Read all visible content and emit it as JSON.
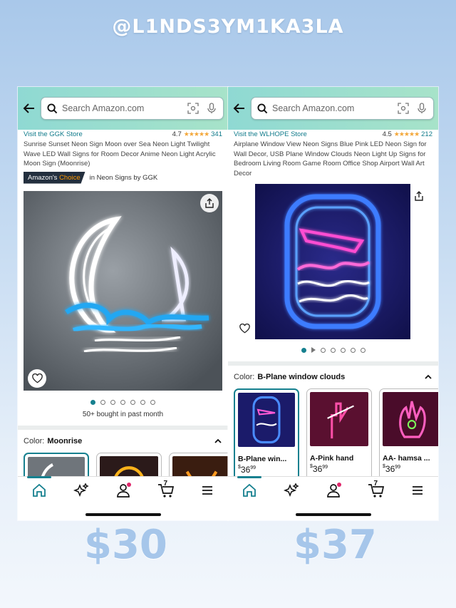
{
  "handle": "@L1NDS3YM1KA3LA",
  "left": {
    "search_placeholder": "Search Amazon.com",
    "store": "Visit the GGK Store",
    "rating": "4.7",
    "stars": "★★★★★",
    "rating_count": "341",
    "title": "Sunrise Sunset Neon Sign Moon over Sea Neon Light Twilight Wave LED Wall Signs for Room Decor Anime Neon Light Acrylic Moon Sign (Moonrise)",
    "choice_prefix": "Amazon's",
    "choice_word": "Choice",
    "choice_category": "in Neon Signs by GGK",
    "bought": "50+ bought in past month",
    "color_label": "Color:",
    "color_value": "Moonrise",
    "swatches": [
      {
        "name": "",
        "price": ""
      },
      {
        "name": "",
        "price": ""
      },
      {
        "name": "",
        "price": ""
      }
    ],
    "cart_count": "7",
    "price_overlay": "$30"
  },
  "right": {
    "search_placeholder": "Search Amazon.com",
    "store": "Visit the WLHOPE Store",
    "rating": "4.5",
    "stars": "★★★★★",
    "rating_count": "212",
    "title": "Airplane Window View Neon Signs Blue Pink LED Neon Sign for Wall Decor, USB Plane Window Clouds Neon Light Up Signs for Bedroom Living Room Game Room Office Shop Airport Wall Art Decor",
    "color_label": "Color:",
    "color_value": "B-Plane window clouds",
    "swatches": [
      {
        "name": "B-Plane win...",
        "price_whole": "36",
        "price_frac": "99",
        "currency": "$"
      },
      {
        "name": "A-Pink hand",
        "price_whole": "36",
        "price_frac": "99",
        "currency": "$"
      },
      {
        "name": "AA- hamsa ...",
        "price_whole": "36",
        "price_frac": "99",
        "currency": "$"
      }
    ],
    "cart_count": "7",
    "price_overlay": "$37"
  },
  "colors": {
    "accent_teal": "#16808f",
    "topbar_start": "#8fd9d3",
    "topbar_end": "#a7e3c9",
    "price_overlay": "#a6c6ea"
  }
}
